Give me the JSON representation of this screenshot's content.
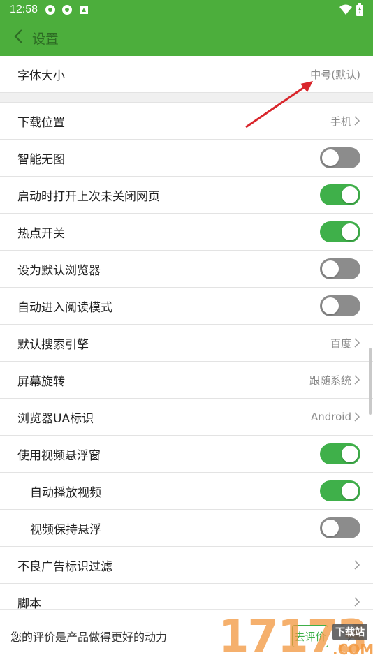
{
  "status_bar": {
    "time": "12:58"
  },
  "header": {
    "title": "设置"
  },
  "settings": {
    "font_size": {
      "label": "字体大小",
      "value": "中号(默认)"
    },
    "download_location": {
      "label": "下载位置",
      "value": "手机"
    },
    "smart_no_image": {
      "label": "智能无图",
      "enabled": false
    },
    "restore_pages": {
      "label": "启动时打开上次未关闭网页",
      "enabled": true
    },
    "hotspot": {
      "label": "热点开关",
      "enabled": true
    },
    "default_browser": {
      "label": "设为默认浏览器",
      "enabled": false
    },
    "auto_reading_mode": {
      "label": "自动进入阅读模式",
      "enabled": false
    },
    "search_engine": {
      "label": "默认搜索引擎",
      "value": "百度"
    },
    "screen_rotation": {
      "label": "屏幕旋转",
      "value": "跟随系统"
    },
    "ua": {
      "label": "浏览器UA标识",
      "value": "Android"
    },
    "video_float": {
      "label": "使用视频悬浮窗",
      "enabled": true
    },
    "auto_play_video": {
      "label": "自动播放视频",
      "enabled": true
    },
    "keep_float": {
      "label": "视频保持悬浮",
      "enabled": false
    },
    "ad_filter": {
      "label": "不良广告标识过滤"
    },
    "script": {
      "label": "脚本"
    }
  },
  "rating_bar": {
    "text": "您的评价是产品做得更好的动力",
    "button": "去评价"
  },
  "watermark": {
    "digits": "17173",
    "site": "下载站",
    "com": ".COM"
  },
  "colors": {
    "accent": "#4cae3c",
    "toggle_on": "#3fb04a",
    "toggle_off": "#8c8c8c",
    "annotation_arrow": "#d9262c"
  },
  "icons": [
    "back-arrow-icon",
    "chevron-right-icon",
    "wifi-icon",
    "battery-icon",
    "close-icon"
  ]
}
